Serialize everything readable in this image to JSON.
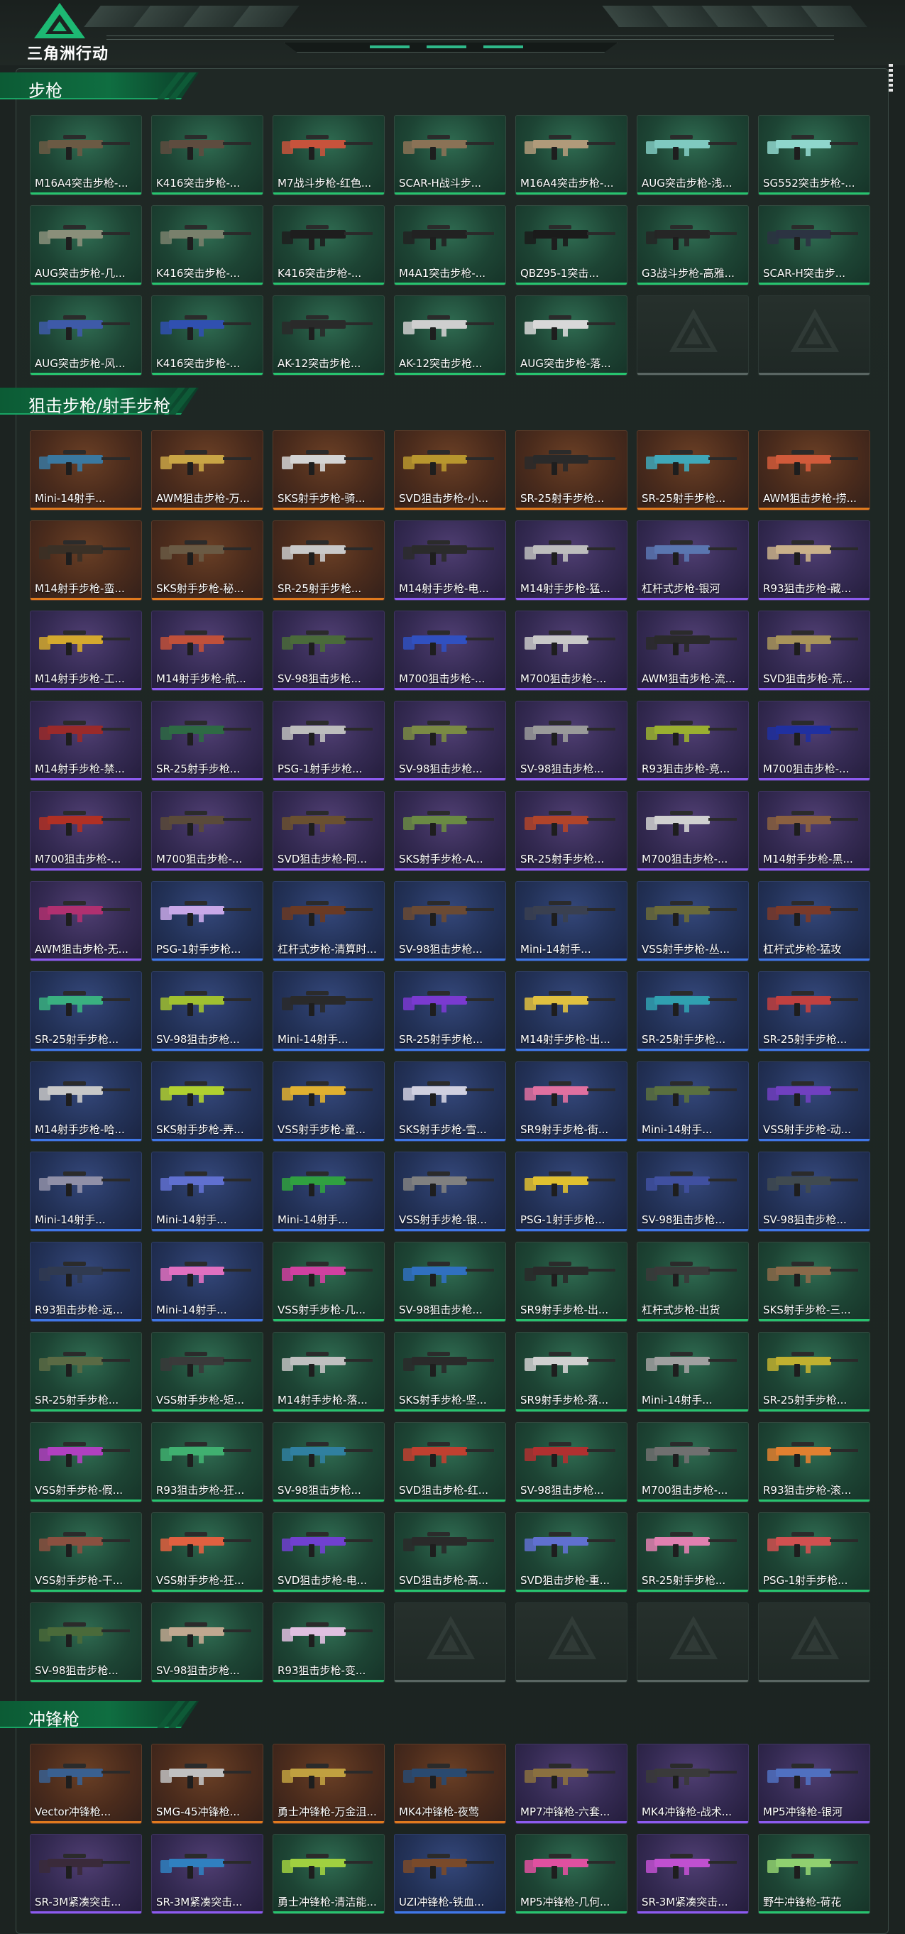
{
  "app": {
    "logo_text": "三角洲行动"
  },
  "icons": {
    "logo": "triangle-delta-logo-icon",
    "empty_slot": "faded-triangle-icon",
    "weapon": "weapon-skin-icon"
  },
  "colors": {
    "accent": "#19a464",
    "rarity_green": "#27c46f",
    "rarity_orange": "#e07a1e",
    "rarity_purple": "#8d5bf0",
    "rarity_blue": "#3f78e8"
  },
  "sections": [
    {
      "title": "步枪",
      "items": [
        {
          "label": "M16A4突击步枪-...",
          "rarity": "green",
          "tone": "#6b5a44"
        },
        {
          "label": "K416突击步枪-...",
          "rarity": "green",
          "tone": "#5e4c3f"
        },
        {
          "label": "M7战斗步枪-红色...",
          "rarity": "green",
          "tone": "#c7533c"
        },
        {
          "label": "SCAR-H战斗步...",
          "rarity": "green",
          "tone": "#8a7256"
        },
        {
          "label": "M16A4突击步枪-...",
          "rarity": "green",
          "tone": "#b09a7a"
        },
        {
          "label": "AUG突击步枪-浅...",
          "rarity": "green",
          "tone": "#7fc9c0"
        },
        {
          "label": "SG552突击步枪-...",
          "rarity": "green",
          "tone": "#8fd6cc"
        },
        {
          "label": "AUG突击步枪-几...",
          "rarity": "green",
          "tone": "#8a8f7a"
        },
        {
          "label": "K416突击步枪-...",
          "rarity": "green",
          "tone": "#79806c"
        },
        {
          "label": "K416突击步枪-...",
          "rarity": "green",
          "tone": "#1e1e1e"
        },
        {
          "label": "M4A1突击步枪-...",
          "rarity": "green",
          "tone": "#222222"
        },
        {
          "label": "QBZ95-1突击...",
          "rarity": "green",
          "tone": "#1b1b1b"
        },
        {
          "label": "G3战斗步枪-高雅...",
          "rarity": "green",
          "tone": "#262626"
        },
        {
          "label": "SCAR-H突击步...",
          "rarity": "green",
          "tone": "#2c3342"
        },
        {
          "label": "AUG突击步枪-风...",
          "rarity": "green",
          "tone": "#3e5aa8"
        },
        {
          "label": "K416突击步枪-...",
          "rarity": "green",
          "tone": "#3050b0"
        },
        {
          "label": "AK-12突击步枪...",
          "rarity": "green",
          "tone": "#2a2a2a"
        },
        {
          "label": "AK-12突击步枪...",
          "rarity": "green",
          "tone": "#cfcfcf"
        },
        {
          "label": "AUG突击步枪-落...",
          "rarity": "green",
          "tone": "#d8d8d8"
        },
        {
          "label": "",
          "rarity": "empty",
          "tone": ""
        },
        {
          "label": "",
          "rarity": "empty",
          "tone": ""
        }
      ]
    },
    {
      "title": "狙击步枪/射手步枪",
      "items": [
        {
          "label": "Mini-14射手...",
          "rarity": "orange",
          "tone": "#3a78a0"
        },
        {
          "label": "AWM狙击步枪-万...",
          "rarity": "orange",
          "tone": "#c9a545"
        },
        {
          "label": "SKS射手步枪-骑...",
          "rarity": "orange",
          "tone": "#d4d4d4"
        },
        {
          "label": "SVD狙击步枪-小...",
          "rarity": "orange",
          "tone": "#b8962e"
        },
        {
          "label": "SR-25射手步枪...",
          "rarity": "orange",
          "tone": "#2a2a2a"
        },
        {
          "label": "SR-25射手步枪...",
          "rarity": "orange",
          "tone": "#3fa7b8"
        },
        {
          "label": "AWM狙击步枪-捞...",
          "rarity": "orange",
          "tone": "#d05a3a"
        },
        {
          "label": "M14射手步枪-蛮...",
          "rarity": "orange",
          "tone": "#3a3026"
        },
        {
          "label": "SKS射手步枪-秘...",
          "rarity": "orange",
          "tone": "#6a5a44"
        },
        {
          "label": "SR-25射手步枪...",
          "rarity": "orange",
          "tone": "#c9c9c9"
        },
        {
          "label": "M14射手步枪-电...",
          "rarity": "purple",
          "tone": "#2b2b2b"
        },
        {
          "label": "M14射手步枪-猛...",
          "rarity": "purple",
          "tone": "#bdbdbd"
        },
        {
          "label": "杠杆式步枪-银河",
          "rarity": "purple",
          "tone": "#5a76b0"
        },
        {
          "label": "R93狙击步枪-藏...",
          "rarity": "purple",
          "tone": "#c9b08a"
        },
        {
          "label": "M14射手步枪-工...",
          "rarity": "purple",
          "tone": "#d4a92e"
        },
        {
          "label": "M14射手步枪-航...",
          "rarity": "purple",
          "tone": "#c0503a"
        },
        {
          "label": "SV-98狙击步枪...",
          "rarity": "purple",
          "tone": "#4a6a3a"
        },
        {
          "label": "M700狙击步枪-...",
          "rarity": "purple",
          "tone": "#3050c0"
        },
        {
          "label": "M700狙击步枪-...",
          "rarity": "purple",
          "tone": "#c8c8c8"
        },
        {
          "label": "AWM狙击步枪-流...",
          "rarity": "purple",
          "tone": "#2a2a2a"
        },
        {
          "label": "SVD狙击步枪-荒...",
          "rarity": "purple",
          "tone": "#a8945a"
        },
        {
          "label": "M14射手步枪-禁...",
          "rarity": "purple",
          "tone": "#9a2a2a"
        },
        {
          "label": "SR-25射手步枪...",
          "rarity": "purple",
          "tone": "#2e6a44"
        },
        {
          "label": "PSG-1射手步枪...",
          "rarity": "purple",
          "tone": "#bdbdbd"
        },
        {
          "label": "SV-98狙击步枪...",
          "rarity": "purple",
          "tone": "#7a8a44"
        },
        {
          "label": "SV-98狙击步枪...",
          "rarity": "purple",
          "tone": "#9a9a9a"
        },
        {
          "label": "R93狙击步枪-竞...",
          "rarity": "purple",
          "tone": "#9ab030"
        },
        {
          "label": "M700狙击步枪-...",
          "rarity": "purple",
          "tone": "#2030a0"
        },
        {
          "label": "M700狙击步枪-...",
          "rarity": "purple",
          "tone": "#b03024"
        },
        {
          "label": "M700狙击步枪-...",
          "rarity": "purple",
          "tone": "#5a4a3a"
        },
        {
          "label": "SVD狙击步枪-阿...",
          "rarity": "purple",
          "tone": "#6a5030"
        },
        {
          "label": "SKS射手步枪-A...",
          "rarity": "purple",
          "tone": "#6a8a44"
        },
        {
          "label": "SR-25射手步枪...",
          "rarity": "purple",
          "tone": "#b0442a"
        },
        {
          "label": "M700狙击步枪-...",
          "rarity": "purple",
          "tone": "#d0d0d0"
        },
        {
          "label": "M14射手步枪-黑...",
          "rarity": "purple",
          "tone": "#8a6040"
        },
        {
          "label": "AWM狙击步枪-无...",
          "rarity": "purple",
          "tone": "#b03070"
        },
        {
          "label": "PSG-1射手步枪...",
          "rarity": "blue",
          "tone": "#c8a8e8"
        },
        {
          "label": "杠杆式步枪-清算时...",
          "rarity": "blue",
          "tone": "#6a3a24"
        },
        {
          "label": "SV-98狙击步枪...",
          "rarity": "blue",
          "tone": "#6a4a34"
        },
        {
          "label": "Mini-14射手...",
          "rarity": "blue",
          "tone": "#3a4050"
        },
        {
          "label": "VSS射手步枪-丛...",
          "rarity": "blue",
          "tone": "#6a6a3a"
        },
        {
          "label": "杠杆式步枪-猛攻",
          "rarity": "blue",
          "tone": "#7a3a2a"
        },
        {
          "label": "SR-25射手步枪...",
          "rarity": "blue",
          "tone": "#3ab080"
        },
        {
          "label": "SV-98狙击步枪...",
          "rarity": "blue",
          "tone": "#a0c030"
        },
        {
          "label": "Mini-14射手...",
          "rarity": "blue",
          "tone": "#2a2a2a"
        },
        {
          "label": "SR-25射手步枪...",
          "rarity": "blue",
          "tone": "#7a3ad0"
        },
        {
          "label": "M14射手步枪-出...",
          "rarity": "blue",
          "tone": "#e0c040"
        },
        {
          "label": "SR-25射手步枪...",
          "rarity": "blue",
          "tone": "#30a0b0"
        },
        {
          "label": "SR-25射手步枪...",
          "rarity": "blue",
          "tone": "#c04040"
        },
        {
          "label": "M14射手步枪-哈...",
          "rarity": "blue",
          "tone": "#c8c8c8"
        },
        {
          "label": "SKS射手步枪-弄...",
          "rarity": "blue",
          "tone": "#b0d030"
        },
        {
          "label": "VSS射手步枪-童...",
          "rarity": "blue",
          "tone": "#e0b030"
        },
        {
          "label": "SKS射手步枪-雪...",
          "rarity": "blue",
          "tone": "#d0d0e0"
        },
        {
          "label": "SR9射手步枪-街...",
          "rarity": "blue",
          "tone": "#e070a0"
        },
        {
          "label": "Mini-14射手...",
          "rarity": "blue",
          "tone": "#5a7040"
        },
        {
          "label": "VSS射手步枪-动...",
          "rarity": "blue",
          "tone": "#7040c0"
        },
        {
          "label": "Mini-14射手...",
          "rarity": "blue",
          "tone": "#9090a8"
        },
        {
          "label": "Mini-14射手...",
          "rarity": "blue",
          "tone": "#6070d0"
        },
        {
          "label": "Mini-14射手...",
          "rarity": "blue",
          "tone": "#30a040"
        },
        {
          "label": "VSS射手步枪-银...",
          "rarity": "blue",
          "tone": "#808080"
        },
        {
          "label": "PSG-1射手步枪...",
          "rarity": "blue",
          "tone": "#e0c030"
        },
        {
          "label": "SV-98狙击步枪...",
          "rarity": "blue",
          "tone": "#4050a0"
        },
        {
          "label": "SV-98狙击步枪...",
          "rarity": "blue",
          "tone": "#404a50"
        },
        {
          "label": "R93狙击步枪-远...",
          "rarity": "blue",
          "tone": "#303a50"
        },
        {
          "label": "Mini-14射手...",
          "rarity": "blue",
          "tone": "#e070c0"
        },
        {
          "label": "VSS射手步枪-几...",
          "rarity": "green",
          "tone": "#d040a0"
        },
        {
          "label": "SV-98狙击步枪...",
          "rarity": "green",
          "tone": "#3070c0"
        },
        {
          "label": "SR9射手步枪-出...",
          "rarity": "green",
          "tone": "#2a2a2a"
        },
        {
          "label": "杠杆式步枪-出货",
          "rarity": "green",
          "tone": "#3a3a3a"
        },
        {
          "label": "SKS射手步枪-三...",
          "rarity": "green",
          "tone": "#8a6a4a"
        },
        {
          "label": "SR-25射手步枪...",
          "rarity": "green",
          "tone": "#5a6a44"
        },
        {
          "label": "VSS射手步枪-矩...",
          "rarity": "green",
          "tone": "#3a3a3a"
        },
        {
          "label": "M14射手步枪-落...",
          "rarity": "green",
          "tone": "#c0c0c0"
        },
        {
          "label": "SKS射手步枪-坚...",
          "rarity": "green",
          "tone": "#2a2a2a"
        },
        {
          "label": "SR9射手步枪-落...",
          "rarity": "green",
          "tone": "#d0d0d0"
        },
        {
          "label": "Mini-14射手...",
          "rarity": "green",
          "tone": "#a0a0a0"
        },
        {
          "label": "SR-25射手步枪...",
          "rarity": "green",
          "tone": "#c0b030"
        },
        {
          "label": "VSS射手步枪-假...",
          "rarity": "green",
          "tone": "#b040c0"
        },
        {
          "label": "R93狙击步枪-狂...",
          "rarity": "green",
          "tone": "#40b070"
        },
        {
          "label": "SV-98狙击步枪...",
          "rarity": "green",
          "tone": "#3080a0"
        },
        {
          "label": "SVD狙击步枪-红...",
          "rarity": "green",
          "tone": "#c04030"
        },
        {
          "label": "SV-98狙击步枪...",
          "rarity": "green",
          "tone": "#b03030"
        },
        {
          "label": "M700狙击步枪-...",
          "rarity": "green",
          "tone": "#707070"
        },
        {
          "label": "R93狙击步枪-滚...",
          "rarity": "green",
          "tone": "#e08030"
        },
        {
          "label": "VSS射手步枪-干...",
          "rarity": "green",
          "tone": "#8a5040"
        },
        {
          "label": "VSS射手步枪-狂...",
          "rarity": "green",
          "tone": "#e06040"
        },
        {
          "label": "SVD狙击步枪-电...",
          "rarity": "green",
          "tone": "#7040d0"
        },
        {
          "label": "SVD狙击步枪-高...",
          "rarity": "green",
          "tone": "#2a2a2a"
        },
        {
          "label": "SVD狙击步枪-重...",
          "rarity": "green",
          "tone": "#6070d0"
        },
        {
          "label": "SR-25射手步枪...",
          "rarity": "green",
          "tone": "#e080b0"
        },
        {
          "label": "PSG-1射手步枪...",
          "rarity": "green",
          "tone": "#d05050"
        },
        {
          "label": "SV-98狙击步枪...",
          "rarity": "green",
          "tone": "#4a6a3a"
        },
        {
          "label": "SV-98狙击步枪...",
          "rarity": "green",
          "tone": "#c0a890"
        },
        {
          "label": "R93狙击步枪-变...",
          "rarity": "green",
          "tone": "#e0c0e0"
        },
        {
          "label": "",
          "rarity": "empty",
          "tone": ""
        },
        {
          "label": "",
          "rarity": "empty",
          "tone": ""
        },
        {
          "label": "",
          "rarity": "empty",
          "tone": ""
        },
        {
          "label": "",
          "rarity": "empty",
          "tone": ""
        }
      ]
    },
    {
      "title": "冲锋枪",
      "items": [
        {
          "label": "Vector冲锋枪...",
          "rarity": "orange",
          "tone": "#3a6090"
        },
        {
          "label": "SMG-45冲锋枪...",
          "rarity": "orange",
          "tone": "#c0c0c0"
        },
        {
          "label": "勇士冲锋枪-万金沮...",
          "rarity": "orange",
          "tone": "#c0a040"
        },
        {
          "label": "MK4冲锋枪-夜莺",
          "rarity": "orange",
          "tone": "#2a4a70"
        },
        {
          "label": "MP7冲锋枪-六套...",
          "rarity": "purple",
          "tone": "#8a7040"
        },
        {
          "label": "MK4冲锋枪-战术...",
          "rarity": "purple",
          "tone": "#3a3a3a"
        },
        {
          "label": "MP5冲锋枪-银河",
          "rarity": "purple",
          "tone": "#5070c0"
        },
        {
          "label": "SR-3M紧凑突击...",
          "rarity": "purple",
          "tone": "#3a2a3a"
        },
        {
          "label": "SR-3M紧凑突击...",
          "rarity": "purple",
          "tone": "#3080c0"
        },
        {
          "label": "勇士冲锋枪-清洁能...",
          "rarity": "green",
          "tone": "#a0d040"
        },
        {
          "label": "UZI冲锋枪-铁血...",
          "rarity": "blue",
          "tone": "#7a4a2a"
        },
        {
          "label": "MP5冲锋枪-几何...",
          "rarity": "green",
          "tone": "#e050a0"
        },
        {
          "label": "SR-3M紧凑突击...",
          "rarity": "purple",
          "tone": "#c050d0"
        },
        {
          "label": "野牛冲锋枪-荷花",
          "rarity": "green",
          "tone": "#90d070"
        }
      ]
    }
  ]
}
